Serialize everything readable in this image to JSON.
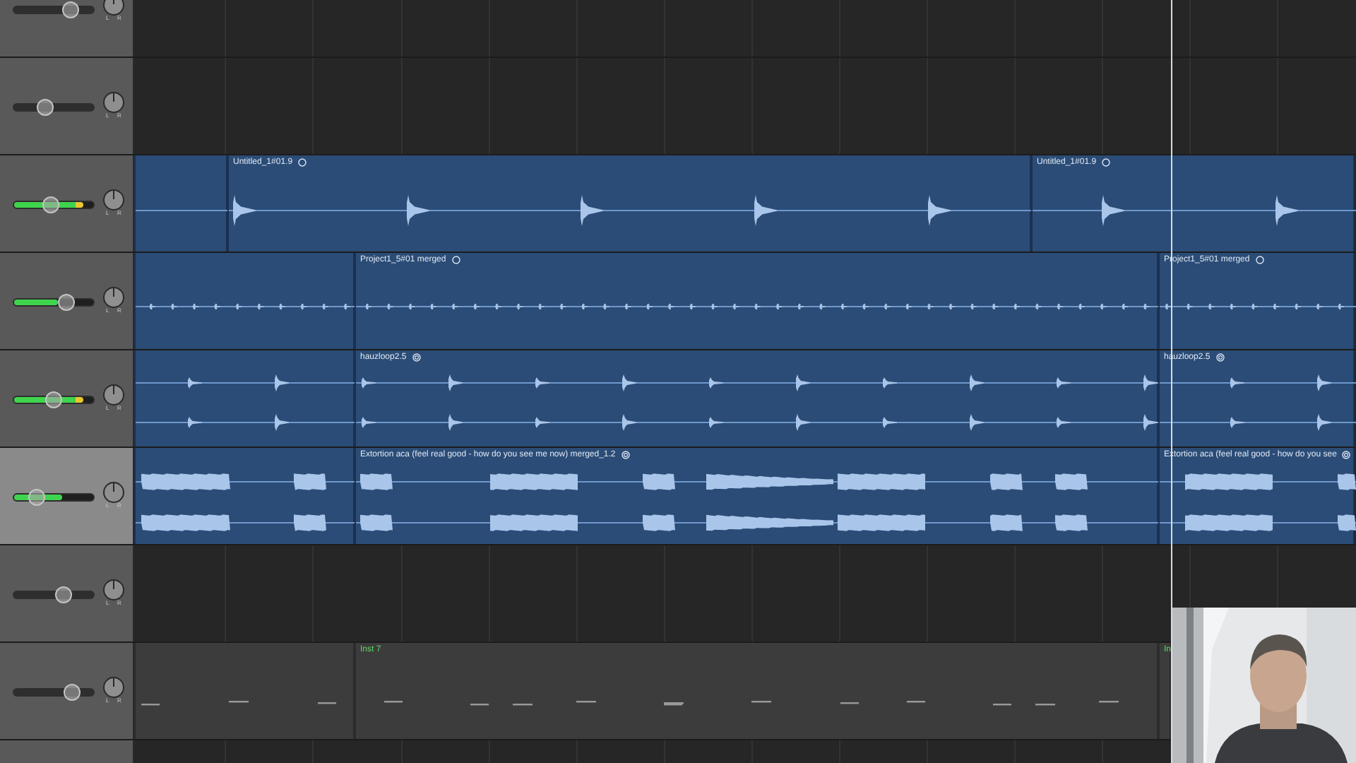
{
  "tracks": [
    {
      "selected": false,
      "volume": {
        "level": 0.7
      },
      "pan_knob": {
        "left": "L",
        "right": "R"
      },
      "lane": {
        "kind": "empty"
      }
    },
    {
      "selected": false,
      "volume": {
        "level": 0.4
      },
      "pan_knob": {
        "left": "L",
        "right": "R"
      },
      "lane": {
        "kind": "empty"
      }
    },
    {
      "selected": false,
      "volume": {
        "level": 0.47
      },
      "meter": {
        "level": 0.88
      },
      "pan_knob": {
        "left": "L",
        "right": "R"
      },
      "lane": {
        "kind": "transient",
        "lead_in": true,
        "regions": [
          {
            "label": "Untitled_1#01.9"
          },
          {
            "label": "Untitled_1#01.9"
          }
        ]
      }
    },
    {
      "selected": false,
      "volume": {
        "level": 0.65
      },
      "meter": {
        "level": 0.56
      },
      "pan_knob": {
        "left": "L",
        "right": "R"
      },
      "lane": {
        "kind": "pulse",
        "lead_in": true,
        "regions": [
          {
            "label": "Project1_5#01 merged"
          },
          {
            "label": "Project1_5#01 merged"
          }
        ]
      }
    },
    {
      "selected": false,
      "volume": {
        "level": 0.5
      },
      "meter": {
        "level": 0.88
      },
      "pan_knob": {
        "left": "L",
        "right": "R"
      },
      "lane": {
        "kind": "loop",
        "lead_in": true,
        "regions": [
          {
            "label": "hauzloop2.5"
          },
          {
            "label": "hauzloop2.5"
          }
        ]
      }
    },
    {
      "selected": true,
      "volume": {
        "level": 0.3
      },
      "meter": {
        "level": 0.6
      },
      "pan_knob": {
        "left": "L",
        "right": "R"
      },
      "lane": {
        "kind": "vocal",
        "lead_in": true,
        "regions": [
          {
            "label": "Extortion aca (feel real good - how do you see me now) merged_1.2"
          },
          {
            "label": "Extortion aca (feel real good - how do you see"
          }
        ]
      }
    },
    {
      "selected": false,
      "volume": {
        "level": 0.62
      },
      "pan_knob": {
        "left": "L",
        "right": "R"
      },
      "lane": {
        "kind": "empty"
      }
    },
    {
      "selected": false,
      "volume": {
        "level": 0.72
      },
      "pan_knob": {
        "left": "L",
        "right": "R"
      },
      "lane": {
        "kind": "midi",
        "lead_in": true,
        "regions": [
          {
            "label": "Inst 7"
          },
          {
            "label": "In"
          }
        ]
      }
    },
    {
      "selected": false,
      "lane": {
        "kind": "empty"
      }
    }
  ]
}
